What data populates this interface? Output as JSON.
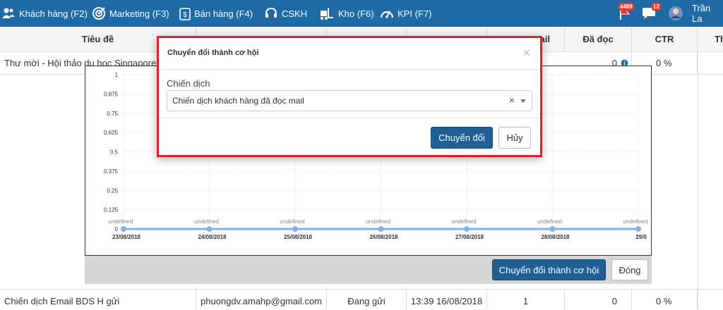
{
  "nav": {
    "items": [
      {
        "label": "Khách hàng (F2)",
        "icon": "users-icon"
      },
      {
        "label": "Marketing (F3)",
        "icon": "target-icon"
      },
      {
        "label": "Bán hàng (F4)",
        "icon": "dollar-bag-icon"
      },
      {
        "label": "CSKH",
        "icon": "headset-icon"
      },
      {
        "label": "Kho (F6)",
        "icon": "forklift-icon"
      },
      {
        "label": "KPI (F7)",
        "icon": "gauge-icon"
      }
    ],
    "flag_badge": "4489",
    "chat_badge": "12",
    "user_name": "Trần La"
  },
  "table": {
    "headers": {
      "title": "Tiêu đề",
      "mail": "ail",
      "read": "Đã đọc",
      "ctr": "CTR",
      "last": "Th"
    },
    "row1": {
      "title": "Thư mời - Hội thảo du học Singapore",
      "read": "0",
      "ctr": "0 %"
    },
    "row2": {
      "title": "Chiến dịch Email BDS H gửi",
      "sender": "phuongdv.amahp@gmail.com",
      "status": "Đang gửi",
      "time": "13:39 16/08/2018",
      "sent": "1",
      "read": "0",
      "ctr": "0 %"
    }
  },
  "chart_footer": {
    "convert_label": "Chuyển đổi thành cơ hội",
    "close_label": "Đóng"
  },
  "modal": {
    "title": "Chuyển đổi thành cơ hội",
    "close_glyph": "×",
    "field_label": "Chiến dịch",
    "selected_value": "Chiến dịch khách hàng đã đọc mail",
    "clear_glyph": "×",
    "convert_label": "Chuyển đổi",
    "cancel_label": "Hủy"
  },
  "chart_data": {
    "type": "line",
    "x": [
      "23/08/2018",
      "24/08/2018",
      "25/08/2018",
      "26/08/2018",
      "27/08/2018",
      "28/08/2018",
      "29/0"
    ],
    "point_labels": [
      "undefined",
      "undefined",
      "undefined",
      "undefined",
      "undefined",
      "undefined",
      "undefined"
    ],
    "values": [
      0,
      0,
      0,
      0,
      0,
      0,
      0
    ],
    "yticks": [
      "0",
      "0.125",
      "0.25",
      "0.375",
      "0.5",
      "0.625",
      "0.75",
      "0.875",
      "1"
    ],
    "ylim": [
      0,
      1
    ],
    "grid": true,
    "color": "#7db4e6"
  }
}
